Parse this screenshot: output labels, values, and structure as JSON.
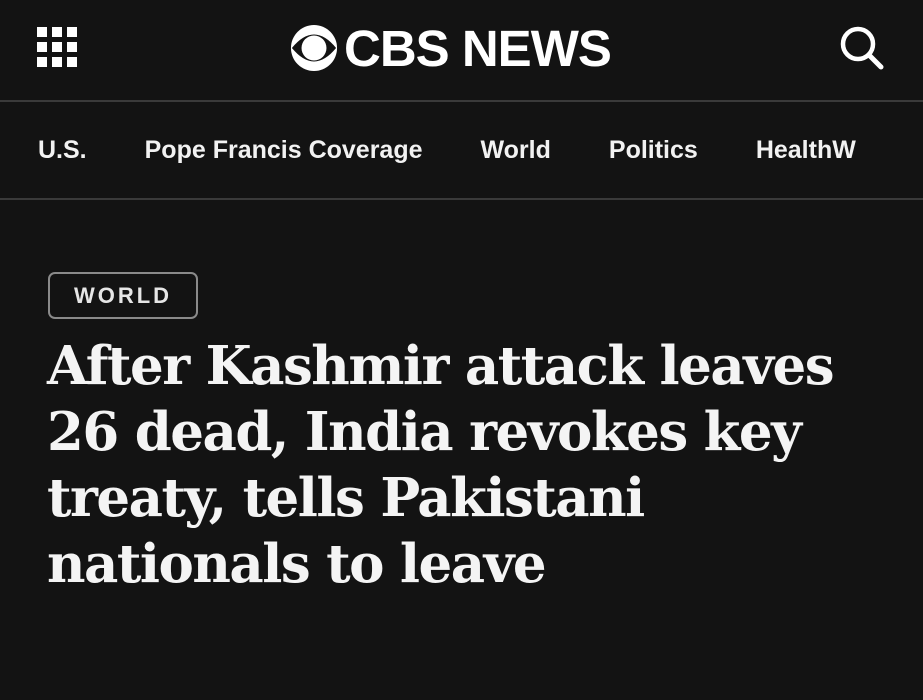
{
  "header": {
    "brand": "CBS NEWS",
    "menu_icon": "grid-menu-icon",
    "logo_icon": "cbs-eye-icon",
    "search_icon": "search-icon"
  },
  "nav": {
    "items": [
      {
        "label": "U.S."
      },
      {
        "label": "Pope Francis Coverage"
      },
      {
        "label": "World"
      },
      {
        "label": "Politics"
      },
      {
        "label": "HealthW"
      }
    ]
  },
  "article": {
    "section_tag": "WORLD",
    "headline": "After Kashmir attack leaves 26 dead, India revokes key treaty, tells Pakistani nationals to leave"
  },
  "colors": {
    "background": "#131313",
    "text": "#ffffff",
    "divider": "#3a3a3a",
    "tag_border": "#8a8a8a"
  }
}
